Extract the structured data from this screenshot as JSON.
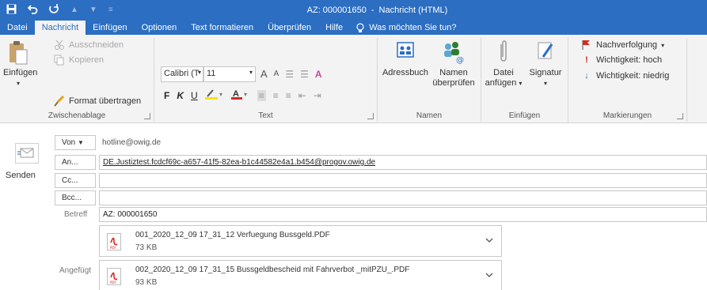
{
  "titlebar": {
    "title": "AZ: 000001650",
    "separator": "-",
    "subtitle": "Nachricht (HTML)"
  },
  "tabs": [
    {
      "label": "Datei"
    },
    {
      "label": "Nachricht",
      "active": true
    },
    {
      "label": "Einfügen"
    },
    {
      "label": "Optionen"
    },
    {
      "label": "Text formatieren"
    },
    {
      "label": "Überprüfen"
    },
    {
      "label": "Hilfe"
    }
  ],
  "tellme": {
    "label": "Was möchten Sie tun?"
  },
  "ribbon": {
    "clipboard": {
      "paste": "Einfügen",
      "cut": "Ausschneiden",
      "copy": "Kopieren",
      "format_painter": "Format übertragen",
      "label": "Zwischenablage"
    },
    "text": {
      "font_name": "Calibri (T",
      "font_size": "11",
      "bold": "F",
      "italic": "K",
      "underline": "U",
      "grow": "A",
      "shrink": "A",
      "label": "Text"
    },
    "names": {
      "address_book": "Adressbuch",
      "check_names_1": "Namen",
      "check_names_2": "überprüfen",
      "label": "Namen"
    },
    "include": {
      "attach_file_1": "Datei",
      "attach_file_2": "anfügen",
      "signature": "Signatur",
      "label": "Einfügen"
    },
    "tags": {
      "follow_up": "Nachverfolgung",
      "high": "Wichtigkeit: hoch",
      "low": "Wichtigkeit: niedrig",
      "label": "Markierungen"
    }
  },
  "compose": {
    "send": "Senden",
    "from_button": "Von",
    "from_value": "hotline@owig.de",
    "to_button": "An...",
    "to_value": "DE.Justiztest.fcdcf69c-a657-41f5-82ea-b1c44582e4a1.b454@progov.owig.de",
    "cc_button": "Cc...",
    "cc_value": "",
    "bcc_button": "Bcc...",
    "bcc_value": "",
    "subject_label": "Betreff",
    "subject_value": "AZ: 000001650",
    "attached_label": "Angefügt",
    "attachments": [
      {
        "name": "001_2020_12_09 17_31_12 Verfuegung Bussgeld.PDF",
        "size": "73 KB"
      },
      {
        "name": "002_2020_12_09 17_31_15 Bussgeldbescheid mit Fahrverbot _mitPZU_.PDF",
        "size": "93 KB"
      }
    ]
  },
  "colors": {
    "accent": "#2b6ec2",
    "ribbon_bg": "#f3f3f3",
    "pdf_red": "#d52b1e"
  }
}
